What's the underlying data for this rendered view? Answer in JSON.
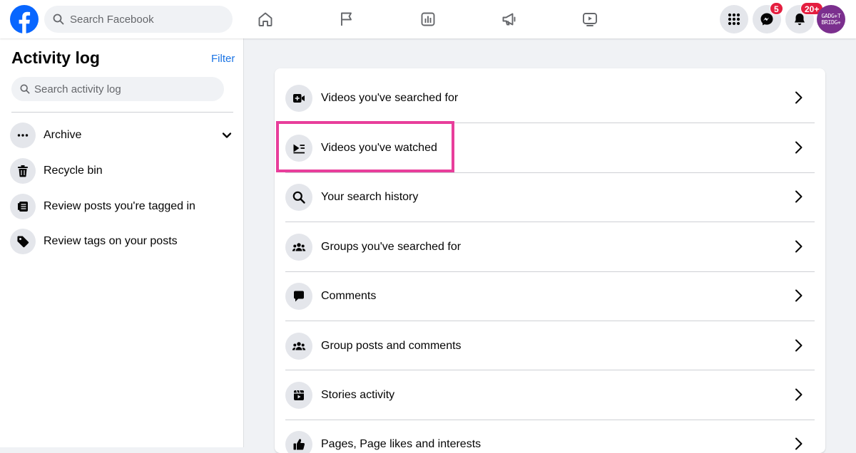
{
  "topbar": {
    "search_placeholder": "Search Facebook",
    "messenger_badge": "5",
    "notifications_badge": "20+",
    "avatar_text_line1": "GADG✳T",
    "avatar_text_line2": "BRIDG✳"
  },
  "sidebar": {
    "title": "Activity log",
    "filter_label": "Filter",
    "search_placeholder": "Search activity log",
    "items": [
      {
        "label": "Archive",
        "icon": "more-icon"
      },
      {
        "label": "Recycle bin",
        "icon": "trash-icon"
      },
      {
        "label": "Review posts you're tagged in",
        "icon": "tagged-posts-icon"
      },
      {
        "label": "Review tags on your posts",
        "icon": "tag-icon"
      }
    ]
  },
  "main": {
    "rows": [
      {
        "label": "Videos you've searched for",
        "icon": "video-search-icon"
      },
      {
        "label": "Videos you've watched",
        "icon": "video-watched-icon",
        "highlighted": true
      },
      {
        "label": "Your search history",
        "icon": "search-icon"
      },
      {
        "label": "Groups you've searched for",
        "icon": "groups-icon"
      },
      {
        "label": "Comments",
        "icon": "comment-icon"
      },
      {
        "label": "Group posts and comments",
        "icon": "groups-icon"
      },
      {
        "label": "Stories activity",
        "icon": "stories-icon"
      },
      {
        "label": "Pages, Page likes and interests",
        "icon": "like-icon"
      }
    ]
  },
  "colors": {
    "brand_blue": "#0866ff",
    "link_blue": "#1b74e4",
    "highlight_pink": "#e83e9b",
    "badge_red": "#e41e3f"
  }
}
